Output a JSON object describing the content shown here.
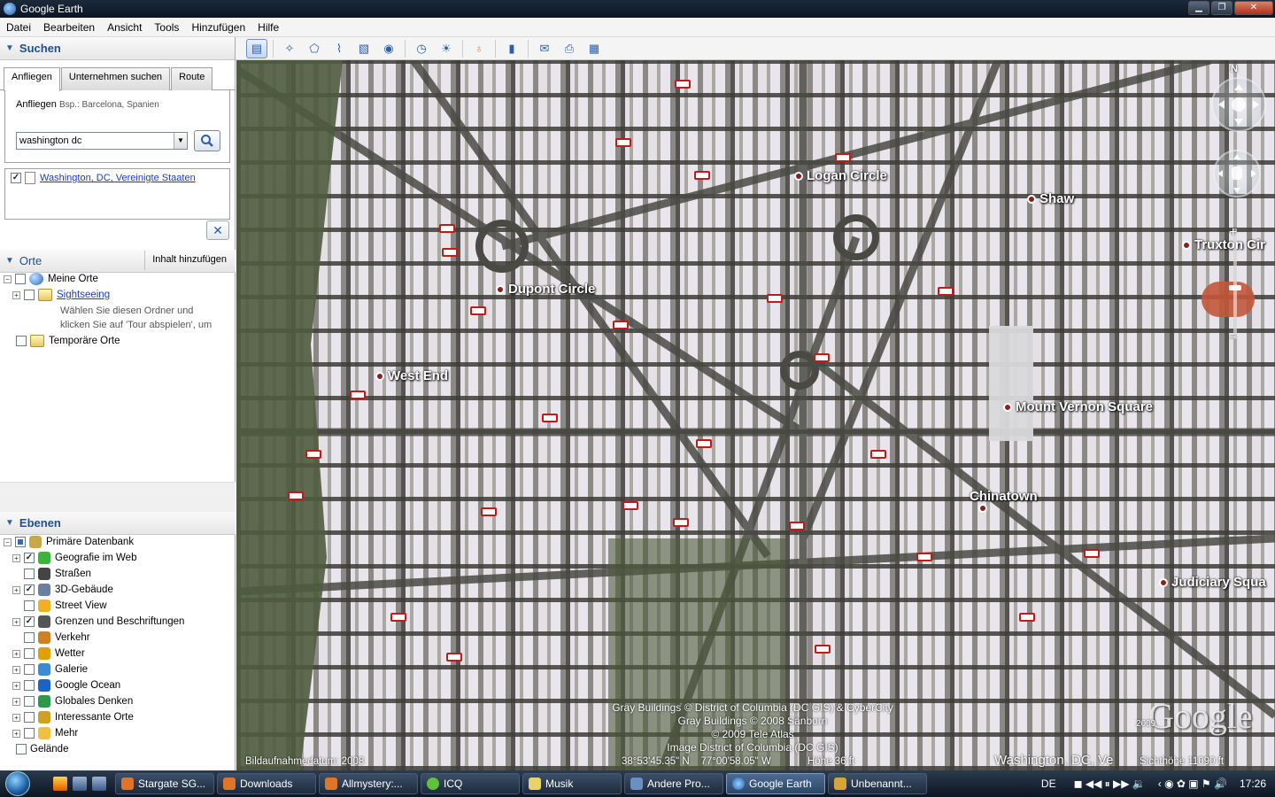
{
  "window": {
    "title": "Google Earth"
  },
  "menu": [
    "Datei",
    "Bearbeiten",
    "Ansicht",
    "Tools",
    "Hinzufügen",
    "Hilfe"
  ],
  "search": {
    "title": "Suchen",
    "tabs": [
      "Anfliegen",
      "Unternehmen suchen",
      "Route"
    ],
    "fly_label": "Anfliegen",
    "fly_hint": "Bsp.: Barcelona, Spanien",
    "query": "washington dc",
    "result": "Washington, DC, Vereinigte Staaten"
  },
  "places": {
    "title": "Orte",
    "add_content": "Inhalt hinzufügen",
    "items": [
      {
        "label": "Meine Orte"
      },
      {
        "label": "Sightseeing",
        "desc1": "Wählen Sie diesen Ordner und",
        "desc2": "klicken Sie auf 'Tour abspielen', um"
      },
      {
        "label": "Temporäre Orte"
      }
    ]
  },
  "layers": {
    "title": "Ebenen",
    "items": [
      {
        "label": "Primäre Datenbank"
      },
      {
        "label": "Geografie im Web"
      },
      {
        "label": "Straßen"
      },
      {
        "label": "3D-Gebäude"
      },
      {
        "label": "Street View"
      },
      {
        "label": "Grenzen und Beschriftungen"
      },
      {
        "label": "Verkehr"
      },
      {
        "label": "Wetter"
      },
      {
        "label": "Galerie"
      },
      {
        "label": "Google Ocean"
      },
      {
        "label": "Globales Denken"
      },
      {
        "label": "Interessante Orte"
      },
      {
        "label": "Mehr"
      },
      {
        "label": "Gelände"
      }
    ]
  },
  "map": {
    "places": [
      "Logan Circle",
      "Shaw",
      "Truxton Cir",
      "Dupont Circle",
      "West End",
      "Mount Vernon Square",
      "Chinatown",
      "Judiciary Squa"
    ],
    "credits": [
      "Gray Buildings © District of Columbia (DC GIS) & CyberCity",
      "Gray Buildings © 2008 Sanborn",
      "© 2009 Tele Atlas",
      "Image District of Columbia (DC GIS)"
    ],
    "logo": "Google",
    "logo_year": "2009",
    "status": {
      "date": "Bildaufnahmedatum: 2008",
      "coords": "38°53'45.35\" N    77°00'58.05\" W",
      "elevation": "Höhe  36 ft",
      "place": "Washington, DC, Ve",
      "eye_alt": "Sichthöhe  11090 ft"
    },
    "north": "N"
  },
  "taskbar": {
    "items": [
      "Stargate SG...",
      "Downloads",
      "Allmystery:...",
      "ICQ",
      "Musik",
      "Andere Pro...",
      "Google Earth",
      "Unbenannt..."
    ],
    "lang": "DE",
    "time": "17:26"
  }
}
